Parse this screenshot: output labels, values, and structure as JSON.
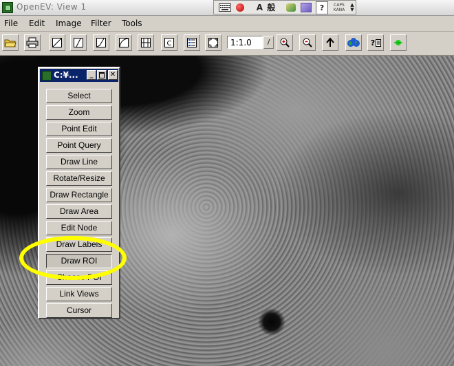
{
  "window": {
    "title": "OpenEV: View 1"
  },
  "ime_bar": {
    "mode_text": "A 般",
    "help": "?",
    "caps": "CAPS",
    "kana": "KANA",
    "arrows": "▲\n▼"
  },
  "menubar": {
    "items": [
      "File",
      "Edit",
      "Image",
      "Filter",
      "Tools"
    ]
  },
  "toolbar": {
    "zoom_value": "1:1.0",
    "zoom_dropdown_glyph": "/",
    "icons": [
      "open-folder-icon",
      "print-icon",
      "raster-ramp-icon",
      "linear-stretch-icon",
      "stretch-alt-icon",
      "stretch-curve-icon",
      "equalize-icon",
      "classify-icon",
      "legend-icon",
      "fit-view-icon",
      "zoom-in-icon",
      "zoom-out-icon",
      "up-arrow-icon",
      "globe-icon",
      "help-icon",
      "green-dot-icon"
    ]
  },
  "palette": {
    "title": "C:¥...",
    "controls": {
      "minimize": "_",
      "close": "✕"
    },
    "buttons": [
      "Select",
      "Zoom",
      "Point Edit",
      "Point Query",
      "Draw Line",
      "Rotate/Resize",
      "Draw Rectangle",
      "Draw Area",
      "Edit Node",
      "Draw Labels",
      "Draw ROI",
      "Choose POI",
      "Link Views",
      "Cursor"
    ],
    "active_button": "Draw ROI",
    "highlight_color": "#ffff00"
  }
}
